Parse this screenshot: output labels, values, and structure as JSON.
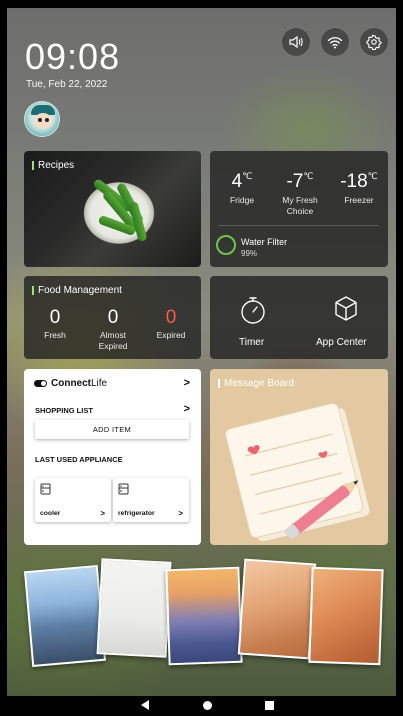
{
  "status": {
    "time": "09:08",
    "date": "Tue, Feb 22, 2022"
  },
  "icons": {
    "sound": "speaker-icon",
    "wifi": "wifi-icon",
    "settings": "gear-icon"
  },
  "recipes": {
    "title": "Recipes"
  },
  "temperatures": {
    "fridge": {
      "value": "4",
      "unit": "℃",
      "label": "Fridge"
    },
    "fresh": {
      "value": "-7",
      "unit": "℃",
      "label_line1": "My Fresh",
      "label_line2": "Choice"
    },
    "freezer": {
      "value": "-18",
      "unit": "℃",
      "label": "Freezer"
    },
    "water_filter": {
      "label": "Water Filter",
      "percent": "99%"
    }
  },
  "food_management": {
    "title": "Food Management",
    "fresh": {
      "count": "0",
      "label": "Fresh"
    },
    "almost": {
      "count": "0",
      "label_line1": "Almost",
      "label_line2": "Expired"
    },
    "expired": {
      "count": "0",
      "label": "Expired"
    }
  },
  "tools": {
    "timer": "Timer",
    "app_center": "App Center"
  },
  "connectlife": {
    "brand_bold": "Connect",
    "brand_light": "Life",
    "shopping_list": "SHOPPING LIST",
    "add_item": "ADD ITEM",
    "last_used": "LAST USED APPLIANCE",
    "appliances": [
      "cooler",
      "refrigerator"
    ],
    "chevron": ">"
  },
  "message_board": {
    "title": "Message Board"
  },
  "colors": {
    "accent_green": "#6bc64a",
    "expired_red": "#ff5a4a",
    "card_dark": "#232323",
    "message_bg": "#e3c9a2"
  }
}
